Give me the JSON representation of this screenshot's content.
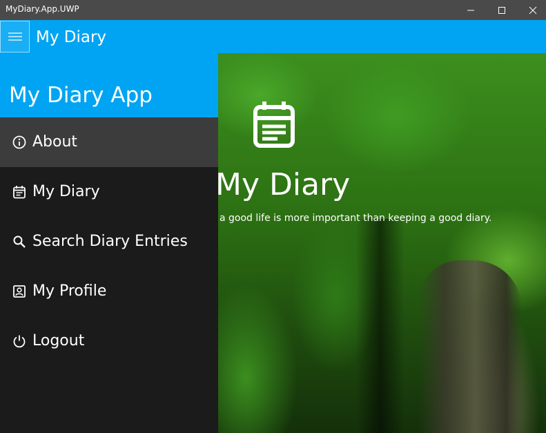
{
  "window": {
    "title": "MyDiary.App.UWP",
    "controls": [
      "minimize-icon",
      "maximize-icon",
      "close-icon"
    ]
  },
  "header": {
    "menu_icon": "hamburger-icon",
    "title": "My Diary"
  },
  "nav": {
    "app_title": "My Diary App",
    "items": [
      {
        "label": "About",
        "icon": "info-icon",
        "selected": true
      },
      {
        "label": "My Diary",
        "icon": "calendar-icon",
        "selected": false
      },
      {
        "label": "Search Diary Entries",
        "icon": "search-icon",
        "selected": false
      },
      {
        "label": "My Profile",
        "icon": "profile-icon",
        "selected": false
      },
      {
        "label": "Logout",
        "icon": "power-icon",
        "selected": false
      }
    ]
  },
  "main": {
    "hero_icon": "diary-note-icon",
    "hero_title": "My Diary",
    "quote": "a good life is more important than keeping a good diary."
  },
  "colors": {
    "accent": "#00a4f2",
    "titlebar": "#4a4a4a",
    "nav_background": "#1b1b1b",
    "nav_selected": "#3c3c3c"
  }
}
